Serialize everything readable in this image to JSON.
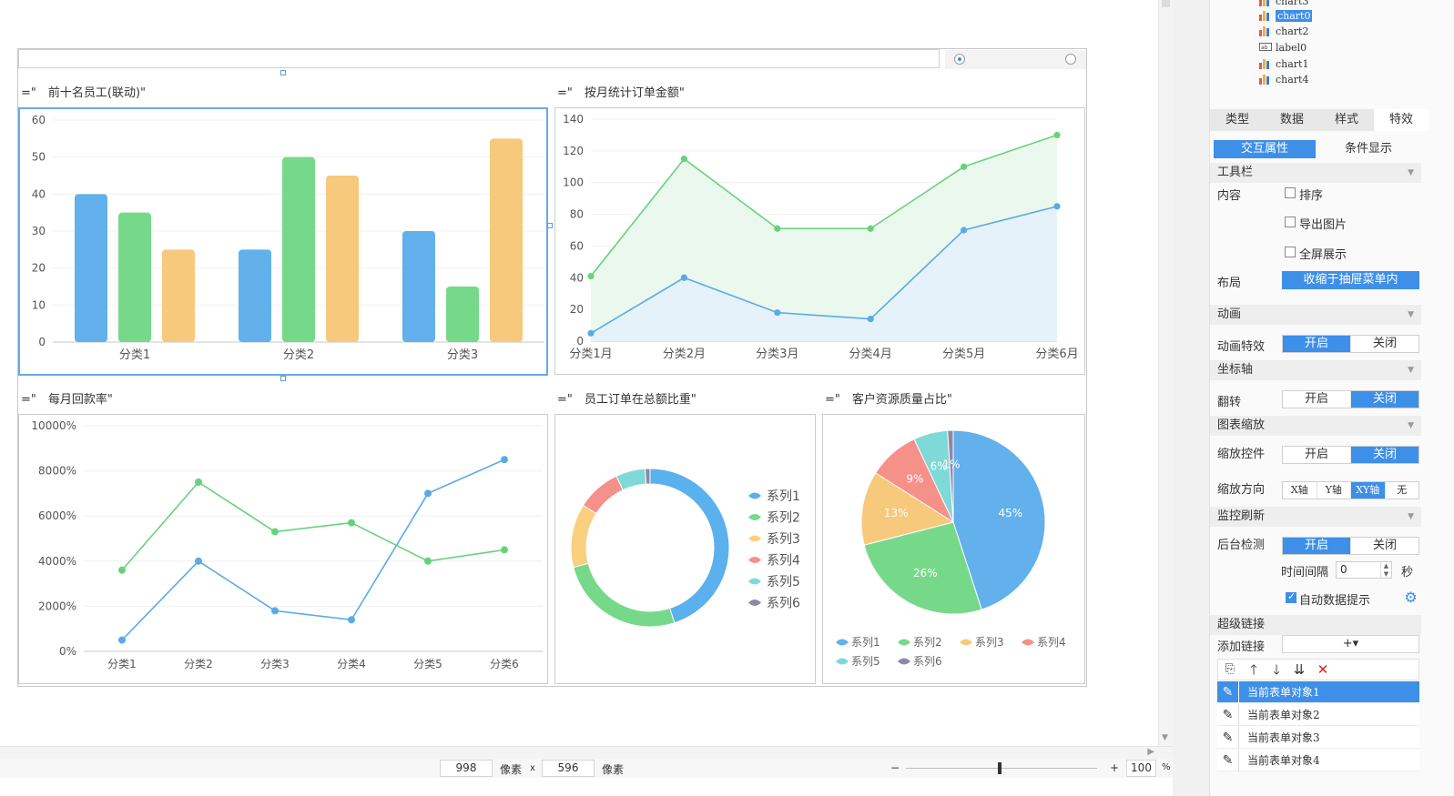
{
  "canvas": {
    "panels": [
      {
        "title": "=\"　前十名员工(联动)\""
      },
      {
        "title": "=\"　按月统计订单金额\""
      },
      {
        "title": "=\"　每月回款率\""
      },
      {
        "title": "=\"　员工订单在总额比重\""
      },
      {
        "title": "=\"　客户资源质量占比\""
      }
    ]
  },
  "chart_data": [
    {
      "type": "bar",
      "categories": [
        "分类1",
        "分类2",
        "分类3"
      ],
      "series": [
        {
          "values": [
            40,
            25,
            30
          ]
        },
        {
          "values": [
            35,
            50,
            15
          ]
        },
        {
          "values": [
            25,
            45,
            55
          ]
        }
      ],
      "ylim": [
        0,
        60
      ],
      "yticks": [
        "0",
        "10",
        "20",
        "30",
        "40",
        "50",
        "60"
      ],
      "colors": [
        "#62b0ec",
        "#76d98a",
        "#f7c97c"
      ],
      "grid": true
    },
    {
      "type": "area",
      "categories": [
        "分类1月",
        "分类2月",
        "分类3月",
        "分类4月",
        "分类5月",
        "分类6月"
      ],
      "series": [
        {
          "values": [
            5,
            40,
            18,
            14,
            70,
            85
          ]
        },
        {
          "values": [
            41,
            115,
            71,
            71,
            110,
            130
          ]
        }
      ],
      "ylim": [
        0,
        140
      ],
      "yticks": [
        "0",
        "20",
        "40",
        "60",
        "80",
        "100",
        "120",
        "140"
      ],
      "colors": [
        "#5aaae6",
        "#67d27c"
      ],
      "grid": true
    },
    {
      "type": "line",
      "categories": [
        "分类1",
        "分类2",
        "分类3",
        "分类4",
        "分类5",
        "分类6"
      ],
      "series": [
        {
          "values": [
            500,
            4000,
            1800,
            1400,
            7000,
            8500
          ]
        },
        {
          "values": [
            3600,
            7500,
            5300,
            5700,
            4000,
            4500
          ]
        }
      ],
      "ylim": [
        0,
        10000
      ],
      "yticks": [
        "0%",
        "2000%",
        "4000%",
        "6000%",
        "8000%",
        "10000%"
      ],
      "colors": [
        "#5aaae6",
        "#67d27c"
      ],
      "grid": true
    },
    {
      "type": "pie",
      "donut": true,
      "values": [
        45,
        26,
        13,
        9,
        6,
        1
      ],
      "legend": [
        "系列1",
        "系列2",
        "系列3",
        "系列4",
        "系列5",
        "系列6"
      ],
      "legend_position": "right",
      "colors": [
        "#5ab1ee",
        "#76d98a",
        "#f9d07e",
        "#f6918a",
        "#7fd9d8",
        "#8d8aa6"
      ]
    },
    {
      "type": "pie",
      "donut": false,
      "values": [
        45,
        26,
        13,
        9,
        6,
        1
      ],
      "labels": [
        "45%",
        "26%",
        "13%",
        "9%",
        "6%",
        "1%"
      ],
      "legend": [
        "系列1",
        "系列2",
        "系列3",
        "系列4",
        "系列5",
        "系列6"
      ],
      "legend_position": "bottom",
      "colors": [
        "#62b0ec",
        "#76d98a",
        "#f7c97c",
        "#f6918a",
        "#7fd9d8",
        "#8d8aa6"
      ]
    }
  ],
  "statusbar": {
    "width_value": "998",
    "unit_px_1": "像素",
    "times": "x",
    "height_value": "596",
    "unit_px_2": "像素",
    "zoom_minus": "−",
    "zoom_plus": "+",
    "zoom_value": "100",
    "zoom_unit": "%"
  },
  "tree": {
    "items": [
      {
        "label": "chart3",
        "icon": "chart-icon"
      },
      {
        "label": "chart0",
        "icon": "chart-icon",
        "active": true
      },
      {
        "label": "chart2",
        "icon": "chart-icon"
      },
      {
        "label": "label0",
        "icon": "label-icon"
      },
      {
        "label": "chart1",
        "icon": "chart-icon"
      },
      {
        "label": "chart4",
        "icon": "chart-icon"
      }
    ]
  },
  "props": {
    "tabs": [
      "类型",
      "数据",
      "样式",
      "特效"
    ],
    "subtabs": [
      "交互属性",
      "条件显示"
    ],
    "toolbar_section": "工具栏",
    "content_label": "内容",
    "cb_sort": "排序",
    "cb_export": "导出图片",
    "cb_fullscreen": "全屏展示",
    "layout_label": "布局",
    "layout_value": "收缩于抽屉菜单内",
    "animation_section": "动画",
    "anim_effect_label": "动画特效",
    "on": "开启",
    "off": "关闭",
    "axis_section": "坐标轴",
    "flip_label": "翻转",
    "zoom_section": "图表缩放",
    "zoom_ctrl_label": "缩放控件",
    "zoom_dir_label": "缩放方向",
    "zoom_dirs": [
      "X轴",
      "Y轴",
      "XY轴",
      "无"
    ],
    "monitor_section": "监控刷新",
    "bg_check_label": "后台检测",
    "interval_label": "时间间隔",
    "interval_value": "0",
    "interval_unit": "秒",
    "auto_tip_label": "自动数据提示",
    "hyperlink_section": "超级链接",
    "add_link_label": "添加链接",
    "add_link_plus": "+▾",
    "links": [
      "当前表单对象1",
      "当前表单对象2",
      "当前表单对象3",
      "当前表单对象4"
    ]
  }
}
